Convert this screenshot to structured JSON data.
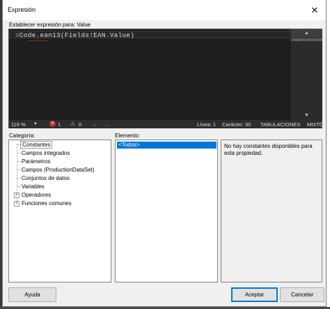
{
  "window": {
    "title": "Expresión",
    "close_glyph": "✕"
  },
  "expression": {
    "label": "Establecer expresión para: Value",
    "code": "=Code.ean13(Fields!EAN.Value)"
  },
  "scroll": {
    "up_glyph": "▲",
    "down_glyph": "▼"
  },
  "statusbar": {
    "zoom": "119 %",
    "zoom_arrow": "▼",
    "error_glyph": "✕",
    "errors": "1",
    "warning_glyph": "⚠",
    "warnings": "0",
    "back_glyph": "←",
    "forward_glyph": "→",
    "line": "Línea: 1",
    "character": "Carácter: 30",
    "tabs": "TABULACIONES",
    "mode": "MIXTO"
  },
  "category": {
    "label": "Categoría:",
    "items": [
      {
        "label": "Constantes",
        "selected": true,
        "expandable": false
      },
      {
        "label": "Campos integrados",
        "selected": false,
        "expandable": false
      },
      {
        "label": "Parámetros",
        "selected": false,
        "expandable": false
      },
      {
        "label": "Campos (ProductionDataSet)",
        "selected": false,
        "expandable": false
      },
      {
        "label": "Conjuntos de datos",
        "selected": false,
        "expandable": false
      },
      {
        "label": "Variables",
        "selected": false,
        "expandable": false
      },
      {
        "label": "Operadores",
        "selected": false,
        "expandable": true
      },
      {
        "label": "Funciones comunes",
        "selected": false,
        "expandable": true
      }
    ],
    "expander_glyph": "+"
  },
  "element": {
    "label": "Elemento:",
    "items": [
      {
        "label": "<Todos>",
        "selected": true
      }
    ]
  },
  "description": {
    "text": "No hay constantes disponibles para esta propiedad."
  },
  "buttons": {
    "help": "Ayuda",
    "accept": "Aceptar",
    "cancel": "Cancelar"
  },
  "colors": {
    "editor_bg": "#1e1e1e",
    "selection": "#0078d7",
    "error": "#c53030",
    "warning": "#e8b400",
    "accent": "#4aa3ff"
  }
}
